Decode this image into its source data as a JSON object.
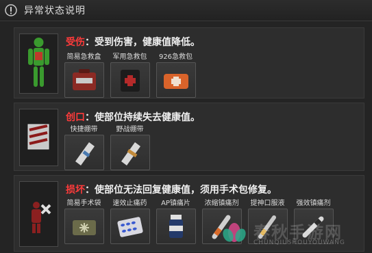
{
  "header": {
    "title": "异常状态说明",
    "icon": "warning-icon"
  },
  "panels": [
    {
      "status": "受伤",
      "text": "：受到伤害，健康值降低。",
      "items": [
        {
          "label": "简易急救盒"
        },
        {
          "label": "军用急救包"
        },
        {
          "label": "926急救包"
        }
      ]
    },
    {
      "status": "创口",
      "text": "：使部位持续失去健康值。",
      "items": [
        {
          "label": "快捷绷带"
        },
        {
          "label": "野战绷带"
        }
      ]
    },
    {
      "status": "损坏",
      "text": "：使部位无法回复健康值，须用手术包修复。",
      "items": [
        {
          "label": "简易手术袋"
        },
        {
          "label": "速效止痛药"
        },
        {
          "label": "AP镇痛片"
        },
        {
          "label": "浓缩镇痛剂"
        },
        {
          "label": "提神口服液"
        },
        {
          "label": "强效镇痛剂"
        }
      ]
    }
  ],
  "watermark": {
    "text": "春秋手游网",
    "sub": "CHUNQIUSHOUYOUWANG"
  },
  "colors": {
    "accent": "#ff3b3b",
    "background": "#242424",
    "panel": "#2d2d2d"
  }
}
